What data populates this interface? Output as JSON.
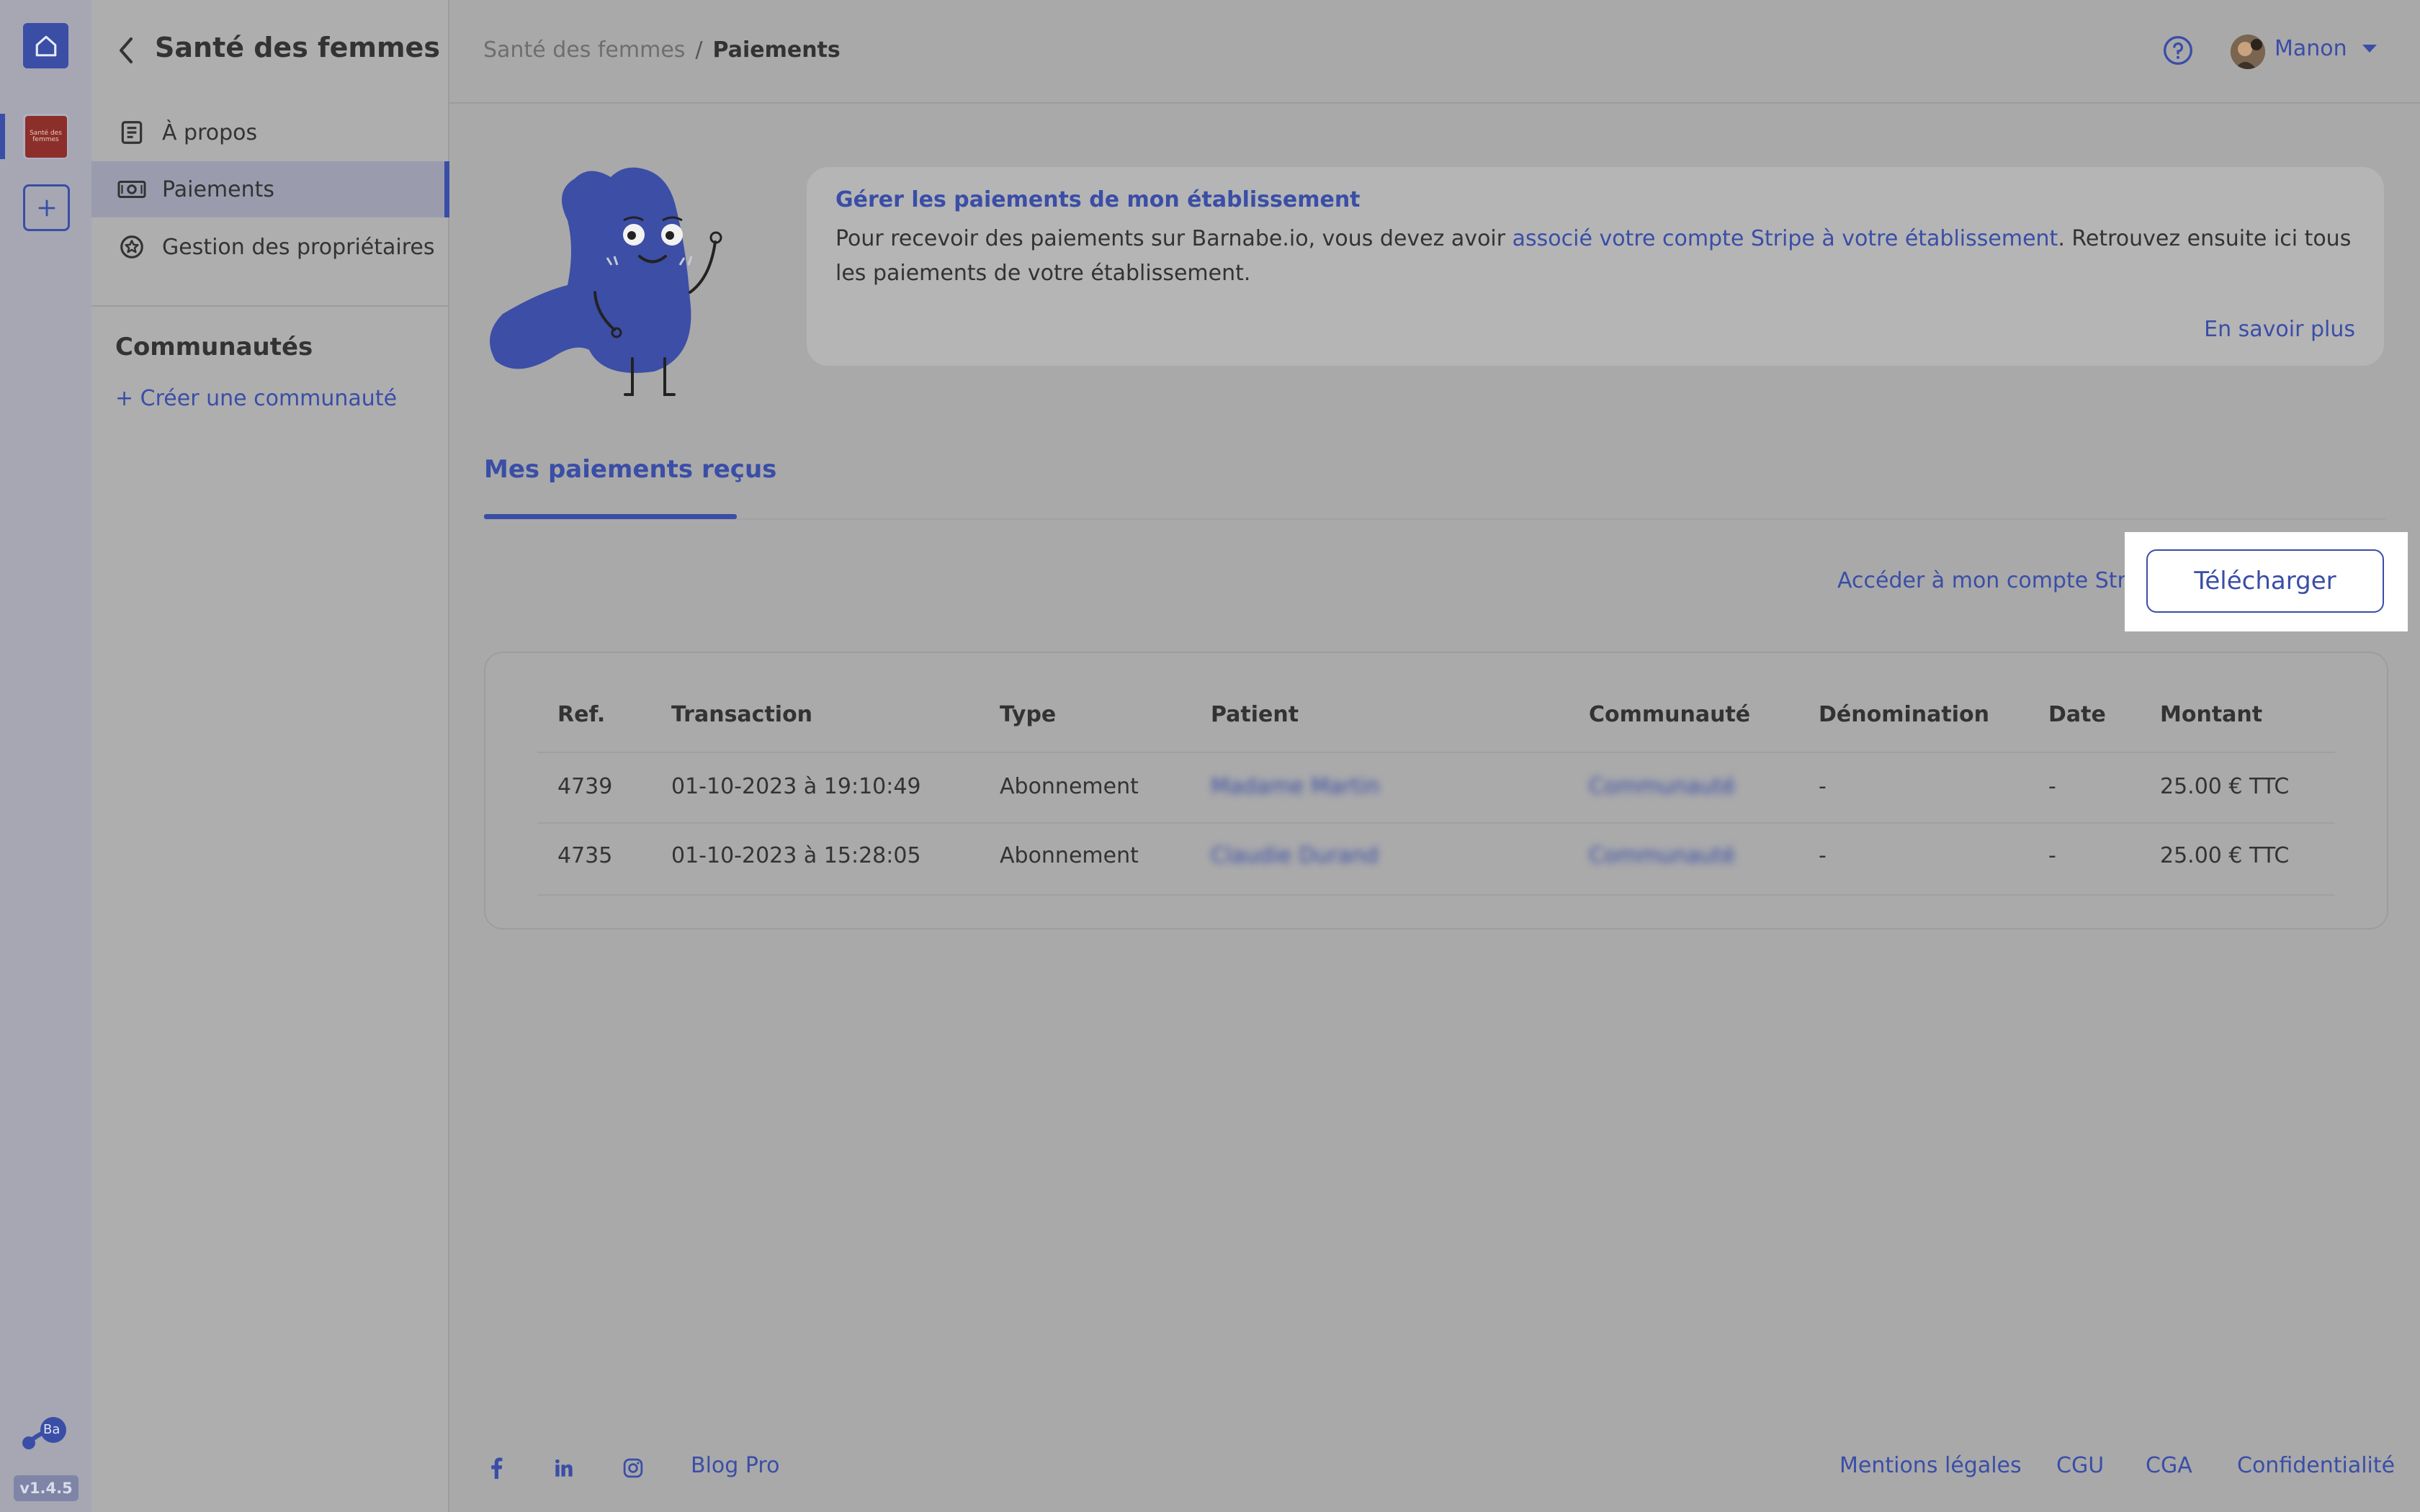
{
  "rail": {
    "org_logo_text": "Santé des femmes",
    "brand_logo_text": "Ba",
    "version": "v1.4.5"
  },
  "sidebar": {
    "title": "Santé des femmes",
    "items": [
      {
        "label": "À propos",
        "icon": "document-icon"
      },
      {
        "label": "Paiements",
        "icon": "banknote-icon",
        "active": true
      },
      {
        "label": "Gestion des propriétaires",
        "icon": "badge-icon"
      }
    ],
    "communities_title": "Communautés",
    "create_community": "+ Créer une communauté"
  },
  "header": {
    "breadcrumb": [
      "Santé des femmes",
      "Paiements"
    ],
    "breadcrumb_separator": "/",
    "user_name": "Manon"
  },
  "info": {
    "title": "Gérer les paiements de mon établissement",
    "text_before": "Pour recevoir des paiements sur Barnabe.io, vous devez avoir ",
    "link": "associé votre compte Stripe à votre établissement",
    "text_after": ". Retrouvez ensuite ici tous les paiements de votre établissement.",
    "more": "En savoir plus"
  },
  "tabs": {
    "active": "Mes paiements reçus"
  },
  "actions": {
    "stripe_link": "Accéder à mon compte Stripe",
    "download": "Télécharger"
  },
  "table": {
    "headers": [
      "Ref.",
      "Transaction",
      "Type",
      "Patient",
      "Communauté",
      "Dénomination",
      "Date",
      "Montant"
    ],
    "rows": [
      {
        "ref": "4739",
        "transaction": "01-10-2023 à 19:10:49",
        "type": "Abonnement",
        "patient": "Madame Martin",
        "community": "Communauté",
        "denomination": "-",
        "date": "-",
        "amount": "25.00 € TTC"
      },
      {
        "ref": "4735",
        "transaction": "01-10-2023 à 15:28:05",
        "type": "Abonnement",
        "patient": "Claudie Durand",
        "community": "Communauté",
        "denomination": "-",
        "date": "-",
        "amount": "25.00 € TTC"
      }
    ]
  },
  "footer": {
    "social": [
      "facebook-icon",
      "linkedin-icon",
      "instagram-icon"
    ],
    "blog": "Blog Pro",
    "links": [
      "Mentions légales",
      "CGU",
      "CGA",
      "Confidentialité"
    ]
  },
  "colors": {
    "accent": "#3a4ea6",
    "overlay_bg": "#a9a9aa"
  }
}
